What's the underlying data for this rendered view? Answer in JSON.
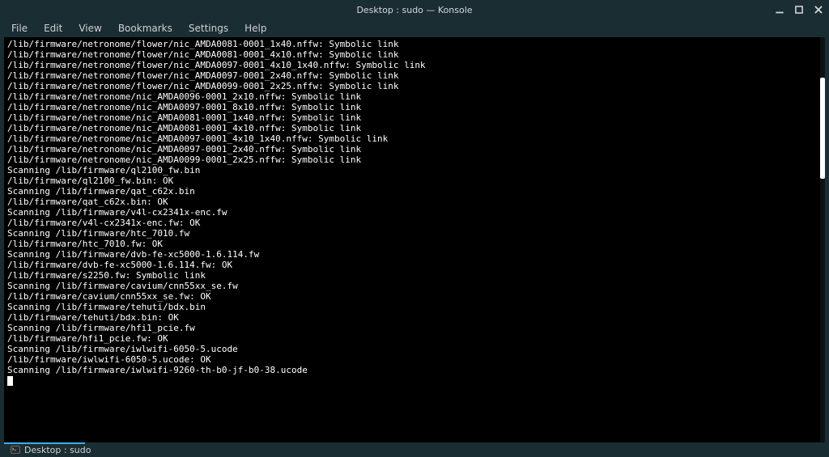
{
  "window": {
    "title": "Desktop : sudo — Konsole"
  },
  "menu": {
    "items": [
      "File",
      "Edit",
      "View",
      "Bookmarks",
      "Settings",
      "Help"
    ]
  },
  "terminal": {
    "lines": [
      "/lib/firmware/netronome/flower/nic_AMDA0081-0001_1x40.nffw: Symbolic link",
      "/lib/firmware/netronome/flower/nic_AMDA0081-0001_4x10.nffw: Symbolic link",
      "/lib/firmware/netronome/flower/nic_AMDA0097-0001_4x10_1x40.nffw: Symbolic link",
      "/lib/firmware/netronome/flower/nic_AMDA0097-0001_2x40.nffw: Symbolic link",
      "/lib/firmware/netronome/flower/nic_AMDA0099-0001_2x25.nffw: Symbolic link",
      "/lib/firmware/netronome/nic_AMDA0096-0001_2x10.nffw: Symbolic link",
      "/lib/firmware/netronome/nic_AMDA0097-0001_8x10.nffw: Symbolic link",
      "/lib/firmware/netronome/nic_AMDA0081-0001_1x40.nffw: Symbolic link",
      "/lib/firmware/netronome/nic_AMDA0081-0001_4x10.nffw: Symbolic link",
      "/lib/firmware/netronome/nic_AMDA0097-0001_4x10_1x40.nffw: Symbolic link",
      "/lib/firmware/netronome/nic_AMDA0097-0001_2x40.nffw: Symbolic link",
      "/lib/firmware/netronome/nic_AMDA0099-0001_2x25.nffw: Symbolic link",
      "Scanning /lib/firmware/ql2100_fw.bin",
      "/lib/firmware/ql2100_fw.bin: OK",
      "Scanning /lib/firmware/qat_c62x.bin",
      "/lib/firmware/qat_c62x.bin: OK",
      "Scanning /lib/firmware/v4l-cx2341x-enc.fw",
      "/lib/firmware/v4l-cx2341x-enc.fw: OK",
      "Scanning /lib/firmware/htc_7010.fw",
      "/lib/firmware/htc_7010.fw: OK",
      "Scanning /lib/firmware/dvb-fe-xc5000-1.6.114.fw",
      "/lib/firmware/dvb-fe-xc5000-1.6.114.fw: OK",
      "/lib/firmware/s2250.fw: Symbolic link",
      "Scanning /lib/firmware/cavium/cnn55xx_se.fw",
      "/lib/firmware/cavium/cnn55xx_se.fw: OK",
      "Scanning /lib/firmware/tehuti/bdx.bin",
      "/lib/firmware/tehuti/bdx.bin: OK",
      "Scanning /lib/firmware/hfi1_pcie.fw",
      "/lib/firmware/hfi1_pcie.fw: OK",
      "Scanning /lib/firmware/iwlwifi-6050-5.ucode",
      "/lib/firmware/iwlwifi-6050-5.ucode: OK",
      "Scanning /lib/firmware/iwlwifi-9260-th-b0-jf-b0-38.ucode"
    ]
  },
  "tab": {
    "label": "Desktop : sudo"
  }
}
